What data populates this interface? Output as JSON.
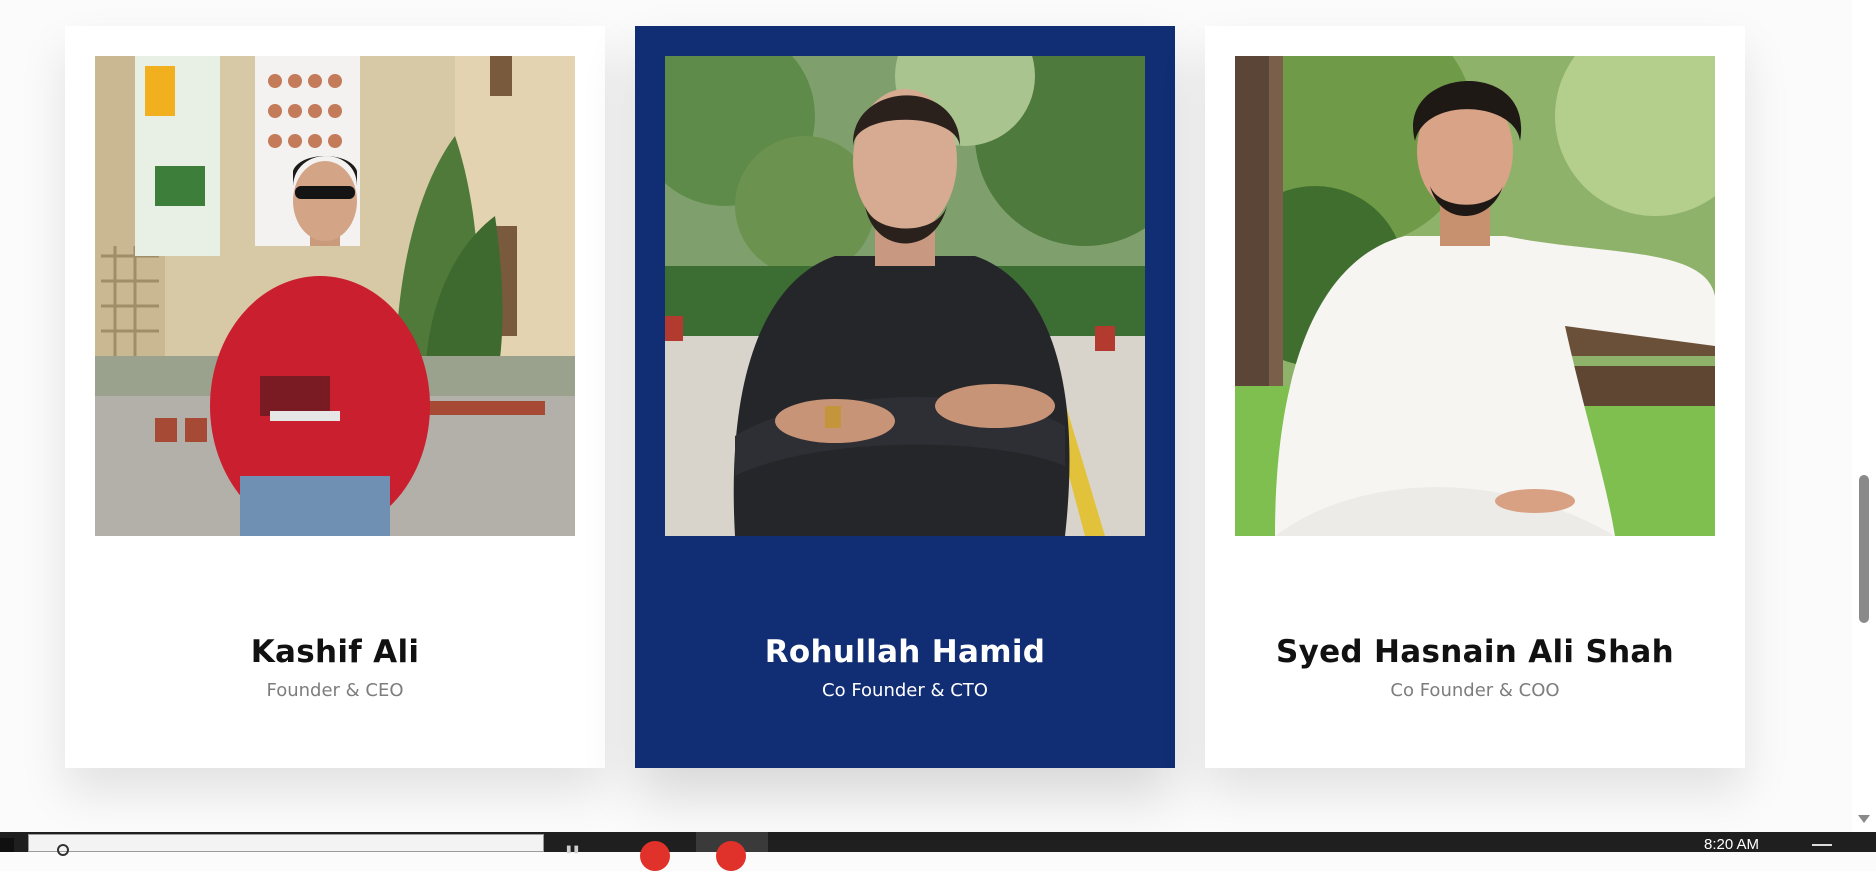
{
  "team": {
    "members": [
      {
        "name": "Kashif Ali",
        "role": "Founder & CEO"
      },
      {
        "name": "Rohullah Hamid",
        "role": "Co Founder & CTO"
      },
      {
        "name": "Syed Hasnain Ali Shah",
        "role": "Co Founder & COO"
      }
    ],
    "highlighted_index": 1
  },
  "colors": {
    "highlight_card": "#112d73",
    "card": "#ffffff",
    "name_text": "#111111",
    "role_text": "#7d7d7d"
  },
  "taskbar": {
    "clock": "8:20 AM"
  }
}
